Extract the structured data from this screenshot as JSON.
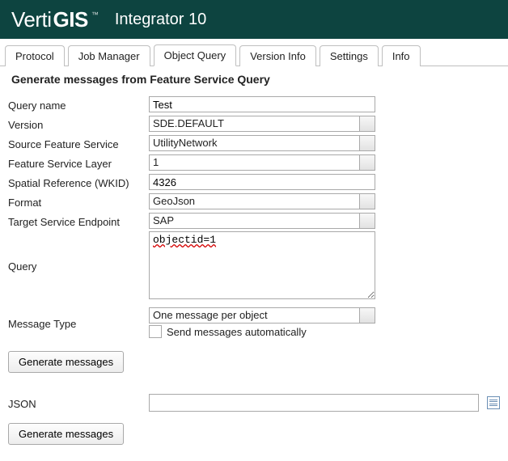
{
  "header": {
    "logo_verti": "Verti",
    "logo_gis": "GIS",
    "tm": "™",
    "app_title": "Integrator 10"
  },
  "tabs": {
    "protocol": "Protocol",
    "job_manager": "Job Manager",
    "object_query": "Object Query",
    "version_info": "Version Info",
    "settings": "Settings",
    "info": "Info"
  },
  "section_title": "Generate messages from Feature Service Query",
  "form": {
    "labels": {
      "query_name": "Query name",
      "version": "Version",
      "source_feature_service": "Source Feature Service",
      "feature_service_layer": "Feature Service Layer",
      "spatial_reference": "Spatial Reference (WKID)",
      "format": "Format",
      "target_service_endpoint": "Target Service Endpoint",
      "query": "Query",
      "message_type": "Message Type",
      "send_automatically": "Send messages automatically",
      "json": "JSON"
    },
    "values": {
      "query_name": "Test",
      "version": "SDE.DEFAULT",
      "source_feature_service": "UtilityNetwork",
      "feature_service_layer": "1",
      "spatial_reference": "4326",
      "format": "GeoJson",
      "target_service_endpoint": "SAP",
      "query": "objectid=1",
      "message_type": "One message per object",
      "send_automatically_checked": false,
      "json": ""
    }
  },
  "buttons": {
    "generate_messages": "Generate messages"
  }
}
